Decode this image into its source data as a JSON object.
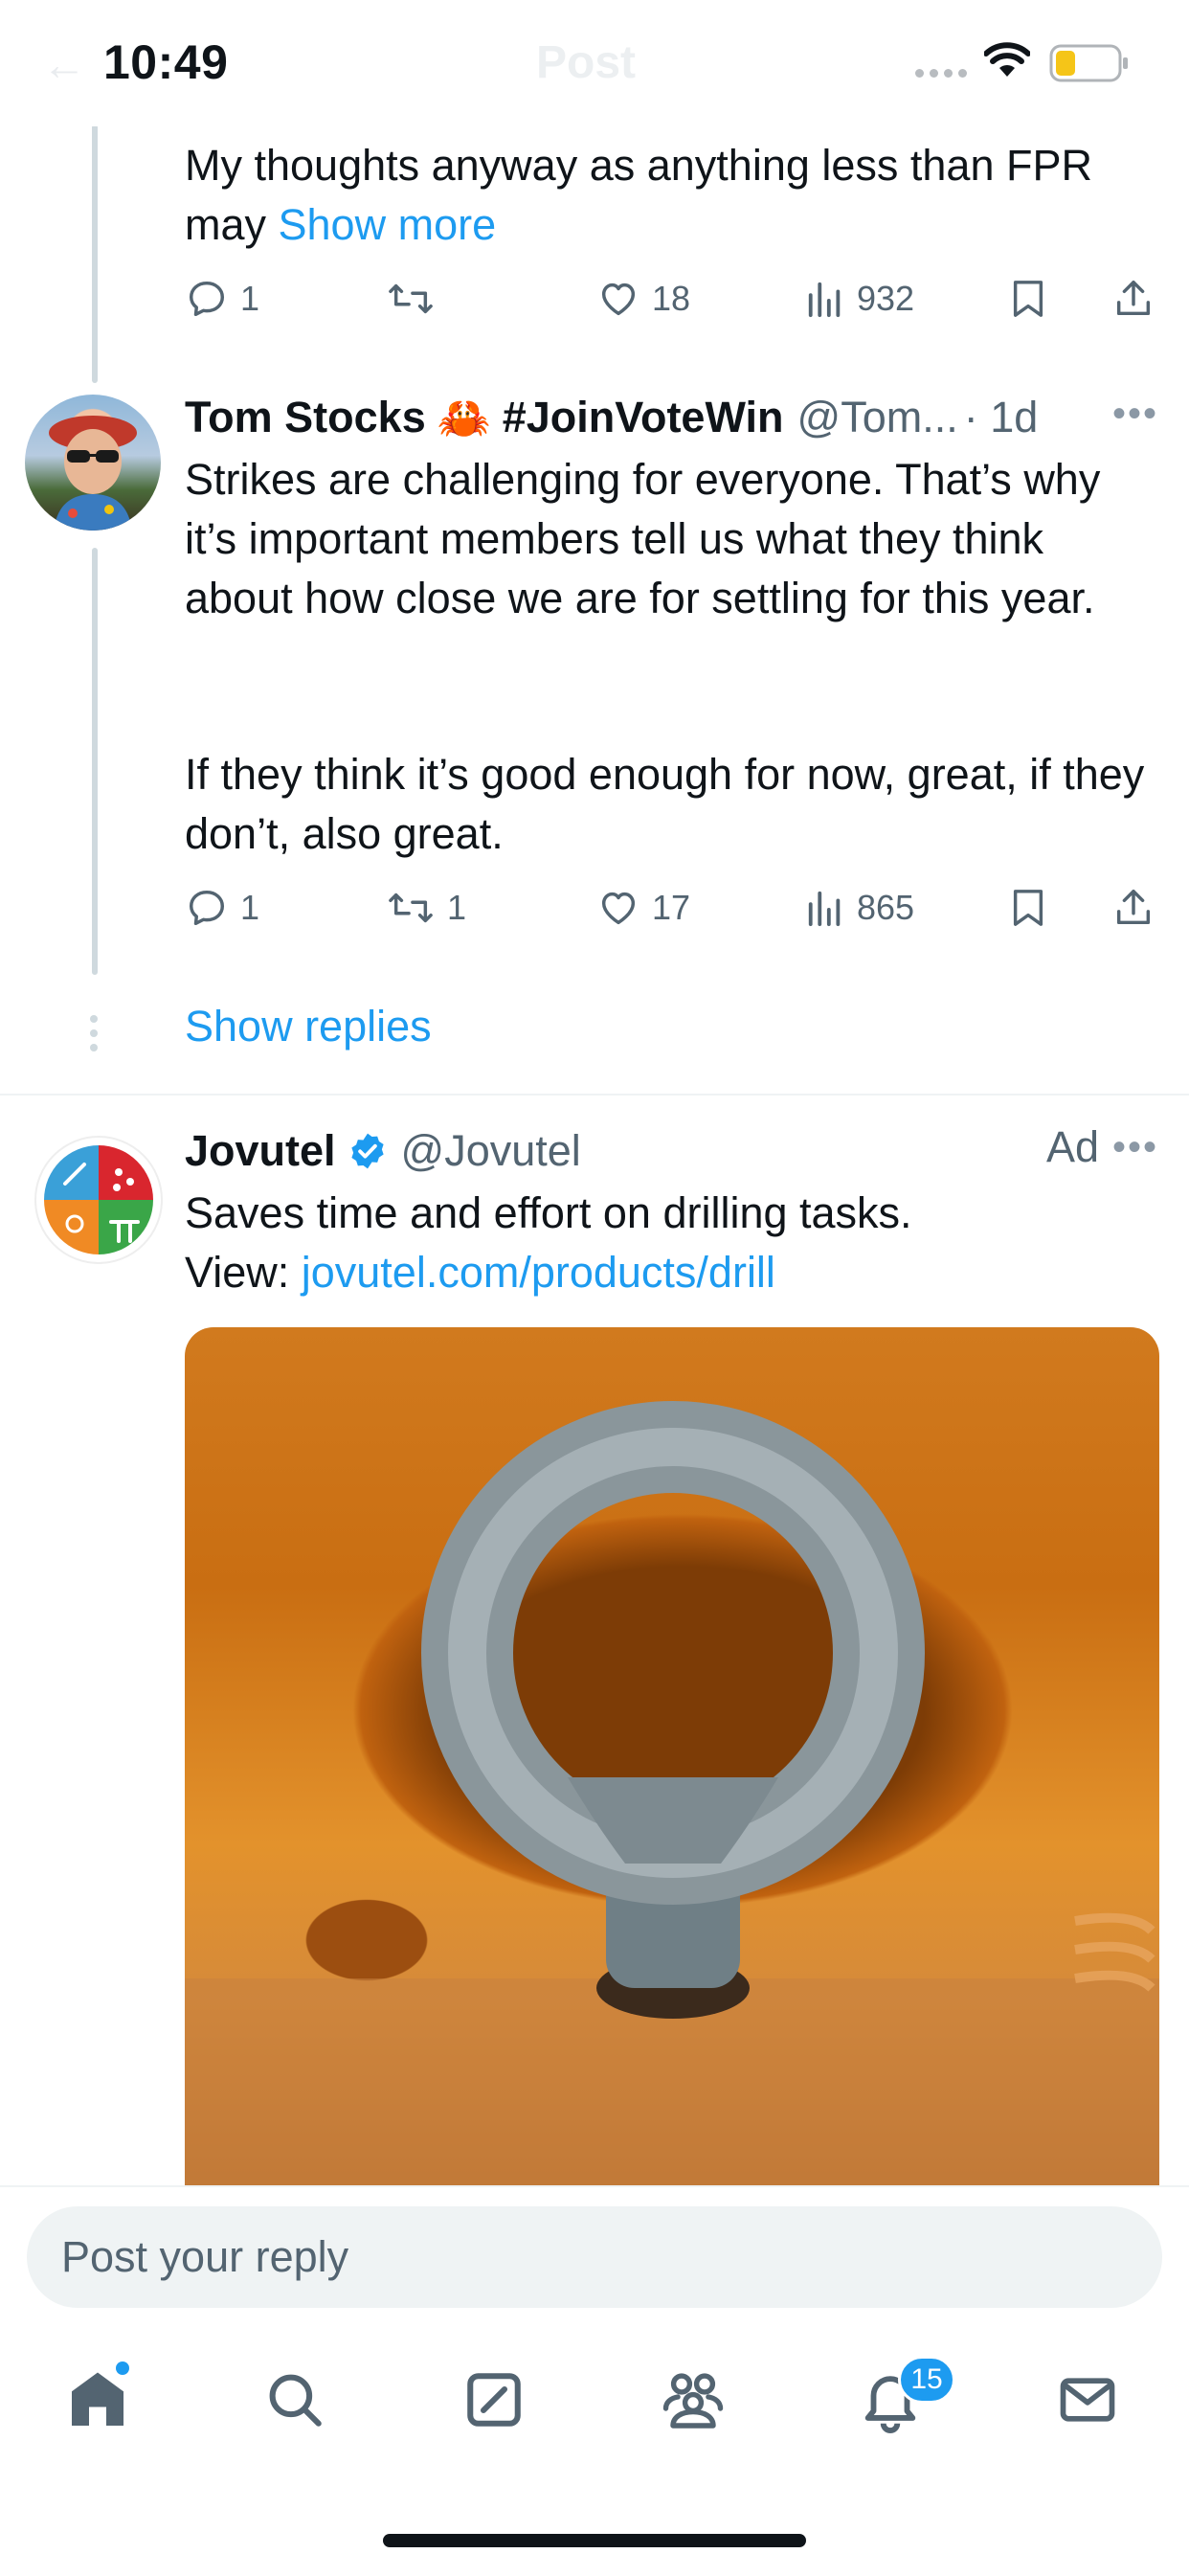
{
  "status_bar": {
    "time": "10:49",
    "faded_title": "Post"
  },
  "tweet1": {
    "text_before": "My thoughts anyway as anything less than FPR may ",
    "show_more": "Show more",
    "reply_count": "1",
    "retweet_count": "",
    "like_count": "18",
    "view_count": "932"
  },
  "tweet2": {
    "name": "Tom Stocks",
    "emoji": "🦀",
    "hashtag": "#JoinVoteWin",
    "handle": "@Tom...",
    "time": "· 1d",
    "paragraph1": "Strikes are challenging for everyone. That’s why it’s important members tell us what they think about how close we are for settling for this year.",
    "paragraph2": "If they think it’s good enough for now, great, if they don’t, also great.",
    "reply_count": "1",
    "retweet_count": "1",
    "like_count": "17",
    "view_count": "865"
  },
  "show_replies": "Show replies",
  "ad": {
    "name": "Jovutel",
    "handle": "@Jovutel",
    "ad_label": "Ad",
    "line1": "Saves time and effort on drilling tasks.",
    "view_prefix": "View: ",
    "link": "jovutel.com/products/drill"
  },
  "reply": {
    "placeholder": "Post your reply"
  },
  "tabs": {
    "items": [
      "home-icon",
      "search-icon",
      "grok-icon",
      "communities-icon",
      "notifications-icon",
      "messages-icon"
    ],
    "notifications_badge": "15"
  },
  "colors": {
    "accent": "#1d9bf0",
    "text": "#0f1419",
    "secondary": "#536471"
  }
}
